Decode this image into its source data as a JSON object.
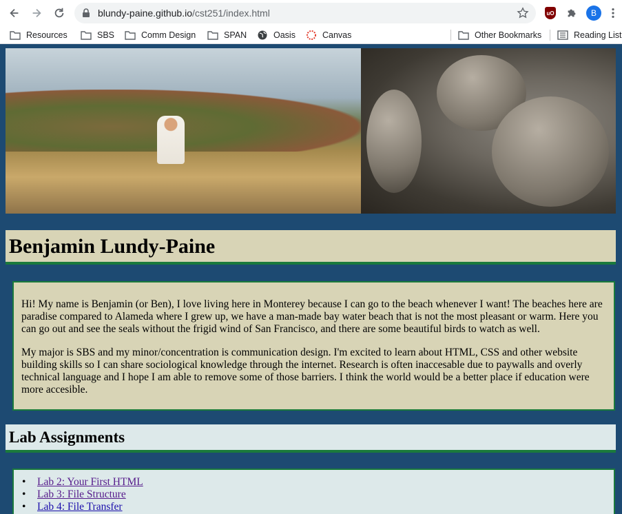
{
  "browser": {
    "url_host": "blundy-paine.github.io",
    "url_path": "/cst251/index.html",
    "profile_initial": "B",
    "extension_badge": "uO",
    "bookmarks": [
      {
        "label": "Resources",
        "icon": "folder-icon"
      },
      {
        "label": "SBS",
        "icon": "folder-icon"
      },
      {
        "label": "Comm Design",
        "icon": "folder-icon"
      },
      {
        "label": "SPAN",
        "icon": "folder-icon"
      },
      {
        "label": "Oasis",
        "icon": "globe-icon"
      },
      {
        "label": "Canvas",
        "icon": "canvas-icon"
      }
    ],
    "other_bookmarks": "Other Bookmarks",
    "reading_list": "Reading List"
  },
  "page": {
    "title": "Benjamin Lundy-Paine",
    "bio_p1": "Hi! My name is Benjamin (or Ben), I love living here in Monterey because I can go to the beach whenever I want! The beaches here are paradise compared to Alameda where I grew up, we have a man-made bay water beach that is not the most pleasant or warm. Here you can go out and see the seals without the frigid wind of San Francisco, and there are some beautiful birds to watch as well.",
    "bio_p2": "My major is SBS and my minor/concentration is communication design. I'm excited to learn about HTML, CSS and other website building skills so I can share sociological knowledge through the internet. Research is often inaccesable due to paywalls and overly technical language and I hope I am able to remove some of those barriers. I think the world would be a better place if education were more accesible.",
    "lab_heading": "Lab Assignments",
    "labs": [
      {
        "label": "Lab 2: Your First HTML"
      },
      {
        "label": "Lab 3: File Structure"
      },
      {
        "label": "Lab 4: File Transfer"
      }
    ]
  },
  "colors": {
    "page_bg": "#1d4a72",
    "box_tan": "#d8d4b6",
    "box_light": "#dde9ea",
    "border_green": "#1a7a3c"
  }
}
